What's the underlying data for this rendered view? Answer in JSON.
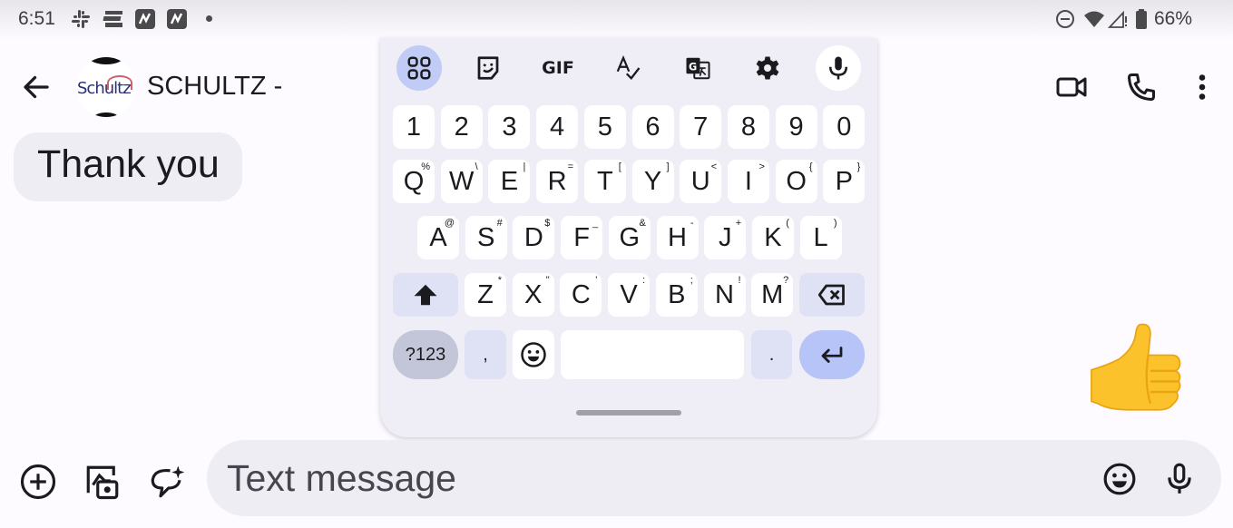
{
  "status_bar": {
    "time": "6:51",
    "left_icons": [
      "slack-icon",
      "news-icon",
      "app-icon",
      "app-icon"
    ],
    "right_icons": [
      "do-not-disturb-icon",
      "wifi-icon",
      "signal-icon",
      "battery-icon"
    ],
    "battery": "66%"
  },
  "header": {
    "back_icon": "arrow-back-icon",
    "avatar_text": "Schultz",
    "contact_name": "SCHULTZ -",
    "actions": [
      "video-call-icon",
      "phone-icon",
      "more-vert-icon"
    ]
  },
  "messages": [
    {
      "direction": "incoming",
      "text": "Thank you"
    }
  ],
  "sent_reaction": {
    "icon": "thumbs-up-emoji",
    "glyph": "👍"
  },
  "keyboard": {
    "toolbar": [
      "apps-grid-icon",
      "sticker-icon",
      "GIF",
      "spellcheck-icon",
      "translate-icon",
      "settings-icon",
      "mic-icon"
    ],
    "row_numbers": [
      "1",
      "2",
      "3",
      "4",
      "5",
      "6",
      "7",
      "8",
      "9",
      "0"
    ],
    "row_top": [
      {
        "k": "Q",
        "h": "%"
      },
      {
        "k": "W",
        "h": "\\"
      },
      {
        "k": "E",
        "h": "|"
      },
      {
        "k": "R",
        "h": "="
      },
      {
        "k": "T",
        "h": "["
      },
      {
        "k": "Y",
        "h": "]"
      },
      {
        "k": "U",
        "h": "<"
      },
      {
        "k": "I",
        "h": ">"
      },
      {
        "k": "O",
        "h": "{"
      },
      {
        "k": "P",
        "h": "}"
      }
    ],
    "row_middle": [
      {
        "k": "A",
        "h": "@"
      },
      {
        "k": "S",
        "h": "#"
      },
      {
        "k": "D",
        "h": "$"
      },
      {
        "k": "F",
        "h": "_"
      },
      {
        "k": "G",
        "h": "&"
      },
      {
        "k": "H",
        "h": "-"
      },
      {
        "k": "J",
        "h": "+"
      },
      {
        "k": "K",
        "h": "("
      },
      {
        "k": "L",
        "h": ")"
      }
    ],
    "row_bottom": [
      {
        "k": "Z",
        "h": "*"
      },
      {
        "k": "X",
        "h": "\""
      },
      {
        "k": "C",
        "h": "'"
      },
      {
        "k": "V",
        "h": ":"
      },
      {
        "k": "B",
        "h": ";"
      },
      {
        "k": "N",
        "h": "!"
      },
      {
        "k": "M",
        "h": "?"
      }
    ],
    "symbols_label": "?123",
    "comma": ",",
    "period": ".",
    "space": ""
  },
  "compose": {
    "placeholder": "Text message",
    "value": "",
    "left_icons": [
      "add-circle-icon",
      "gallery-camera-icon",
      "magic-compose-icon"
    ],
    "right_icons": [
      "emoji-icon",
      "mic-icon"
    ]
  },
  "colors": {
    "accent_light": "#c0cbf6",
    "enter_key": "#b6c4f7",
    "bubble_bg": "#eeedf4"
  }
}
